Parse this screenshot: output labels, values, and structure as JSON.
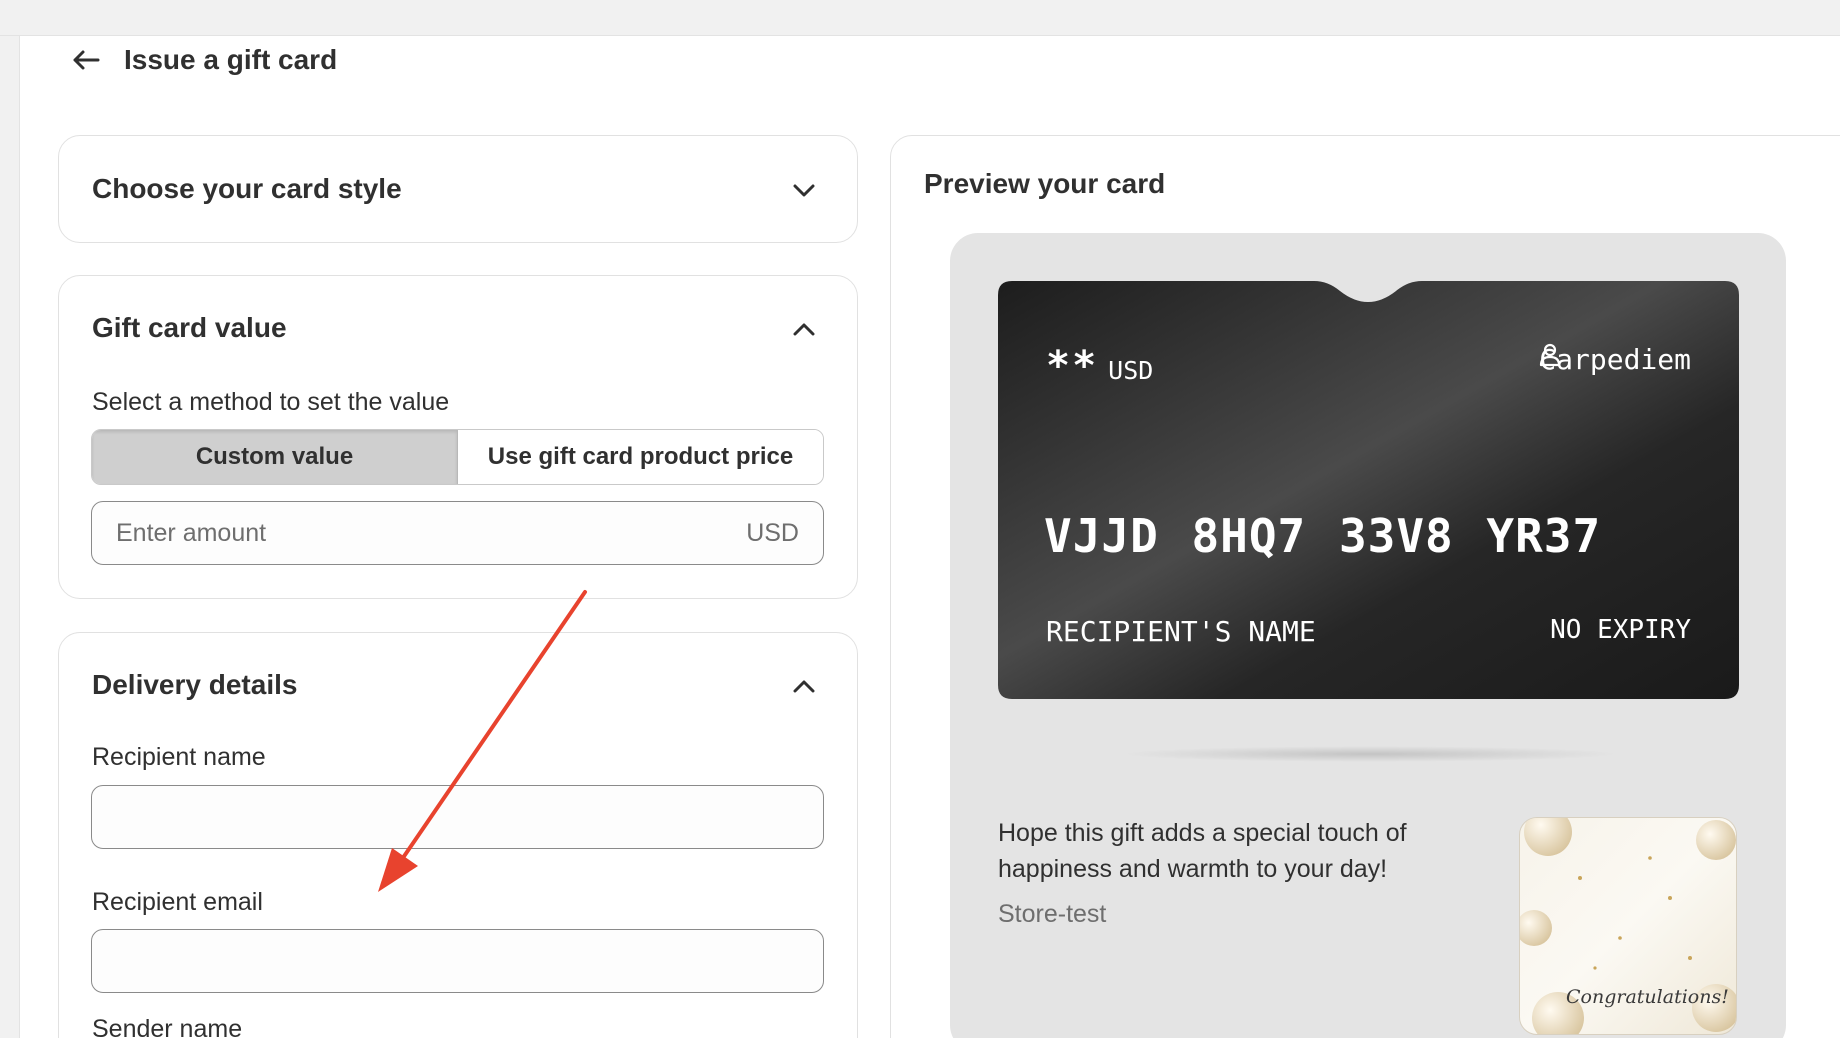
{
  "header": {
    "title": "Issue a gift card"
  },
  "card_style": {
    "title": "Choose your card style"
  },
  "gift_value": {
    "title": "Gift card value",
    "method_label": "Select a method to set the value",
    "options": [
      "Custom value",
      "Use gift card product price"
    ],
    "selected": "Custom value",
    "amount_placeholder": "Enter amount",
    "amount_currency": "USD"
  },
  "delivery": {
    "title": "Delivery details",
    "recipient_name_label": "Recipient name",
    "recipient_email_label": "Recipient email",
    "sender_name_label": "Sender name"
  },
  "preview": {
    "title": "Preview your card",
    "card": {
      "amount": "**",
      "currency": "USD",
      "store": "Carpediem",
      "code": "VJJD 8HQ7 33V8 YR37",
      "recipient": "RECIPIENT'S NAME",
      "expiry": "NO EXPIRY"
    },
    "message": "Hope this gift adds a special touch of happiness and warmth to your day!",
    "sender": "Store-test",
    "thumbnail_text": "Congratulations!"
  },
  "colors": {
    "annotation_arrow": "#e8432e",
    "card_dark": "#2a2a2a"
  }
}
